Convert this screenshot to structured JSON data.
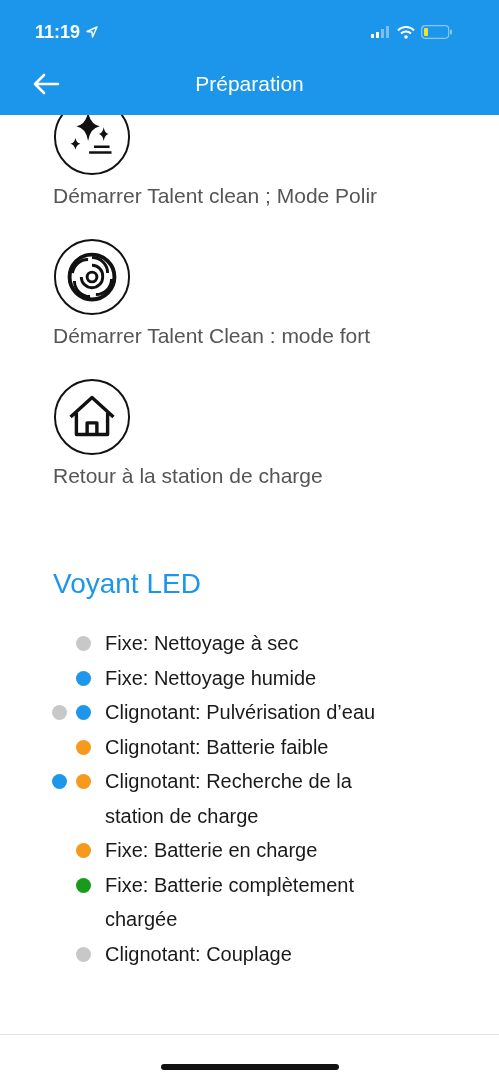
{
  "status_bar": {
    "time": "11:19"
  },
  "header": {
    "title": "Préparation"
  },
  "actions": [
    {
      "kind": "sparkle",
      "label": "Démarrer Talent clean ; Mode Polir"
    },
    {
      "kind": "swirl",
      "label": "Démarrer Talent Clean : mode fort"
    },
    {
      "kind": "home",
      "label": "Retour à la station de charge"
    }
  ],
  "led_section": {
    "title": "Voyant LED",
    "items": [
      {
        "dots": [
          {
            "color": "#c8c8c8"
          }
        ],
        "text": "Fixe: Nettoyage à sec"
      },
      {
        "dots": [
          {
            "color": "#1e96ea"
          }
        ],
        "text": "Fixe: Nettoyage humide"
      },
      {
        "dots": [
          {
            "color": "#c8c8c8"
          },
          {
            "color": "#1e96ea"
          }
        ],
        "text": "Clignotant: Pulvérisation d’eau"
      },
      {
        "dots": [
          {
            "color": "#f59a1c"
          }
        ],
        "text": "Clignotant: Batterie faible"
      },
      {
        "dots": [
          {
            "color": "#1e96ea"
          },
          {
            "color": "#f59a1c"
          }
        ],
        "text": "Clignotant: Recherche de la station de charge"
      },
      {
        "dots": [
          {
            "color": "#f59a1c"
          }
        ],
        "text": "Fixe: Batterie en charge"
      },
      {
        "dots": [
          {
            "color": "#1a9a1a"
          }
        ],
        "text": "Fixe: Batterie complètement chargée"
      },
      {
        "dots": [
          {
            "color": "#c8c8c8"
          }
        ],
        "text": "Clignotant: Couplage"
      }
    ]
  }
}
